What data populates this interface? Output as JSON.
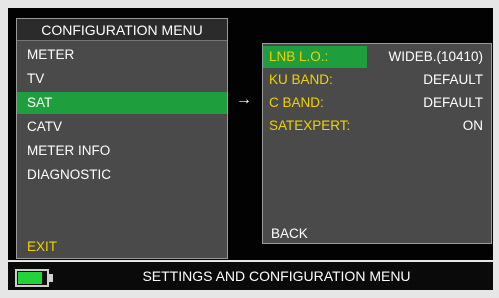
{
  "left_menu": {
    "title": "CONFIGURATION MENU",
    "items": [
      {
        "label": "METER"
      },
      {
        "label": "TV"
      },
      {
        "label": "SAT",
        "selected": true
      },
      {
        "label": "CATV"
      },
      {
        "label": "METER INFO"
      },
      {
        "label": "DIAGNOSTIC"
      }
    ],
    "exit_label": "EXIT"
  },
  "arrow": "→",
  "submenu": {
    "rows": [
      {
        "label": "LNB L.O.:",
        "value": "WIDEB.(10410)",
        "selected": true
      },
      {
        "label": "KU BAND:",
        "value": "DEFAULT"
      },
      {
        "label": "C BAND:",
        "value": "DEFAULT"
      },
      {
        "label": "SATEXPERT:",
        "value": "ON"
      }
    ],
    "back_label": "BACK"
  },
  "status_bar": {
    "battery_icon": "battery-icon",
    "text": "SETTINGS AND CONFIGURATION MENU"
  },
  "colors": {
    "selection": "#1e9e3d",
    "label_yellow": "#f2d200",
    "battery_green": "#22d33a"
  }
}
